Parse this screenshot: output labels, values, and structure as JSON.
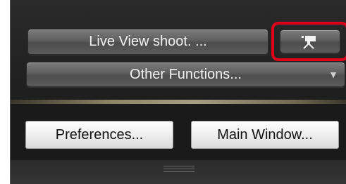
{
  "buttons": {
    "live_view": "Live View shoot. ...",
    "other_functions": "Other Functions...",
    "other_functions_arrow": "▼",
    "preferences": "Preferences...",
    "main_window": "Main Window..."
  },
  "icons": {
    "movie": "movie-camera-icon",
    "dropdown": "triangle-down-icon",
    "resize_grip": "resize-grip-icon"
  },
  "colors": {
    "highlight": "#e0001b"
  }
}
